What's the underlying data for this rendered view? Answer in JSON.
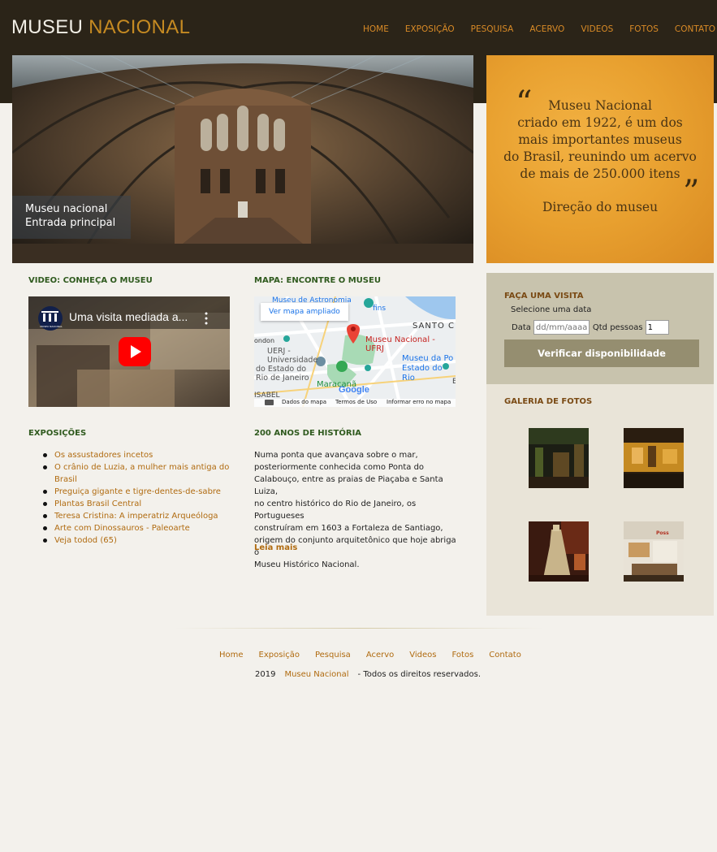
{
  "header": {
    "logo_part1": "MUSEU",
    "logo_part2": "NACIONAL",
    "nav": [
      "HOME",
      "EXPOSIÇÃO",
      "PESQUISA",
      "ACERVO",
      "VIDEOS",
      "FOTOS",
      "CONTATO"
    ]
  },
  "hero": {
    "caption_line1": "Museu nacional",
    "caption_line2": "Entrada principal"
  },
  "quote": {
    "open_mark": "“",
    "close_mark": "”",
    "lines": [
      "Museu Nacional",
      "criado em 1922, é um dos",
      "mais importantes museus",
      "do Brasil, reunindo um acervo",
      "de mais de 250.000 itens"
    ],
    "signature": "Direção do museu"
  },
  "video": {
    "section_title": "VIDEO: CONHEÇA O MUSEU",
    "title": "Uma visita mediada a...",
    "channel_badge": "MUSEU NACIONAL"
  },
  "map": {
    "section_title": "MAPA: ENCONTRE O MUSEU",
    "expand_link": "Ver mapa ampliado",
    "labels": [
      "Museu de Astronomia",
      "fins",
      "SANTO C",
      "Museu Nacional - UFRJ",
      "ondon",
      "UERJ -",
      "Universidade",
      "do Estado do",
      "Rio de Janeiro",
      "Museu da Po",
      "Estado do Rio",
      "Maracanã",
      "ISABEL",
      "E"
    ],
    "google": "Google",
    "footer": [
      "Dados do mapa",
      "Termos de Uso",
      "Informar erro no mapa"
    ]
  },
  "exhibits": {
    "section_title": "EXPOSIÇÕES",
    "items": [
      "Os assustadores incetos",
      "O crânio de Luzia, a mulher mais antiga do",
      "Brasil",
      "Preguiça gigante e tigre-dentes-de-sabre",
      "Plantas Brasil Central",
      "Teresa Cristina: A imperatriz Arqueóloga",
      "Arte com Dinossauros - Paleoarte",
      "Veja todod (65)"
    ]
  },
  "history": {
    "section_title": "200 ANOS DE HISTÓRIA",
    "lines": [
      "Numa ponta que avançava sobre o mar,",
      "posteriormente conhecida como Ponta do",
      "Calabouço, entre as praias de Piaçaba e Santa Luiza,",
      "no centro histórico do Rio de Janeiro, os Portugueses",
      "construíram em 1603 a Fortaleza de Santiago,",
      "origem do conjunto arquitetônico que hoje abriga o",
      "Museu Histórico Nacional."
    ],
    "read_more": "Leia mais"
  },
  "visit": {
    "title": "FAÇA UMA VISITA",
    "subtitle": "Selecione uma data",
    "date_label": "Data",
    "date_placeholder": "dd/mm/aaaa",
    "qty_label": "Qtd pessoas",
    "qty_value": "1",
    "button": "Verificar disponibilidade"
  },
  "gallery": {
    "title": "GALERIA DE FOTOS",
    "photo4_sign": "Poss"
  },
  "footer": {
    "nav": [
      "Home",
      "Exposição",
      "Pesquisa",
      "Acervo",
      "Videos",
      "Fotos",
      "Contato"
    ],
    "year": "2019",
    "link": "Museu Nacional",
    "rights": "- Todos os direitos reservados."
  },
  "colors": {
    "header_bg": "#2b2418",
    "accent": "#b06b10",
    "nav": "#d88a26",
    "section_title": "#2f5a1e",
    "quote_bg": "#e8a02f",
    "visit_bg": "#c8c3ad",
    "button_bg": "#958e70",
    "page_bg": "#f3f1ec"
  }
}
